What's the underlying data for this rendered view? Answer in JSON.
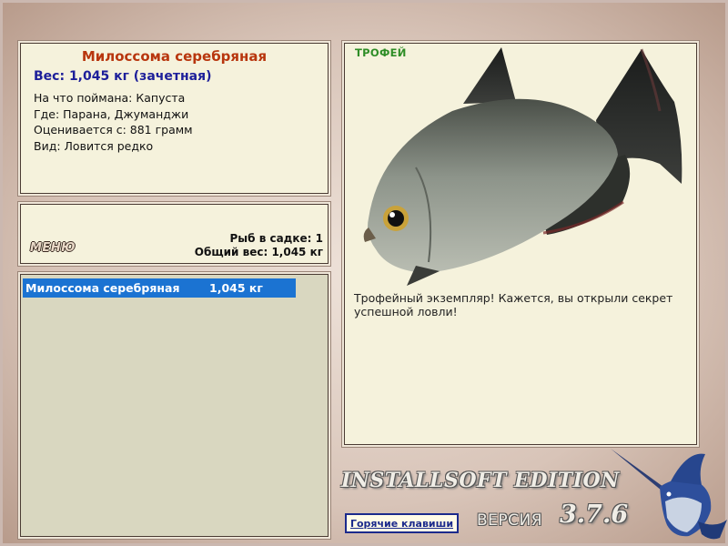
{
  "fish": {
    "name": "Милоссома серебряная",
    "weight_line": "Вес: 1,045 кг (зачетная)",
    "details": [
      "На что поймана: Капуста",
      "Где: Парана, Джуманджи",
      "Оценивается с: 881 грамм",
      "Вид: Ловится редко"
    ]
  },
  "menu": {
    "label": "МЕНЮ"
  },
  "cage": {
    "count_line": "Рыб в садке: 1",
    "total_line": "Общий вес: 1,045 кг"
  },
  "catch_list": [
    {
      "name": "Милоссома серебряная",
      "weight": "1,045 кг"
    }
  ],
  "trophy": {
    "tag": "ТРОФЕЙ",
    "message": "Трофейный экземпляр! Кажется, вы открыли секрет успешной ловли!",
    "image": "silver-dollar-fish-picture"
  },
  "branding": {
    "edition": "INSTALLSOFT EDITION",
    "version_word": "ВЕРСИЯ",
    "version_number": "3.7.6",
    "logo": "marlin-logo"
  },
  "hotkeys_label": "Горячие клавиши",
  "colors": {
    "panel_bg": "#f5f2dc",
    "title": "#b8360e",
    "weight": "#1d1f9a",
    "selection": "#1b73d2",
    "trophy_tag": "#2e8d26"
  }
}
